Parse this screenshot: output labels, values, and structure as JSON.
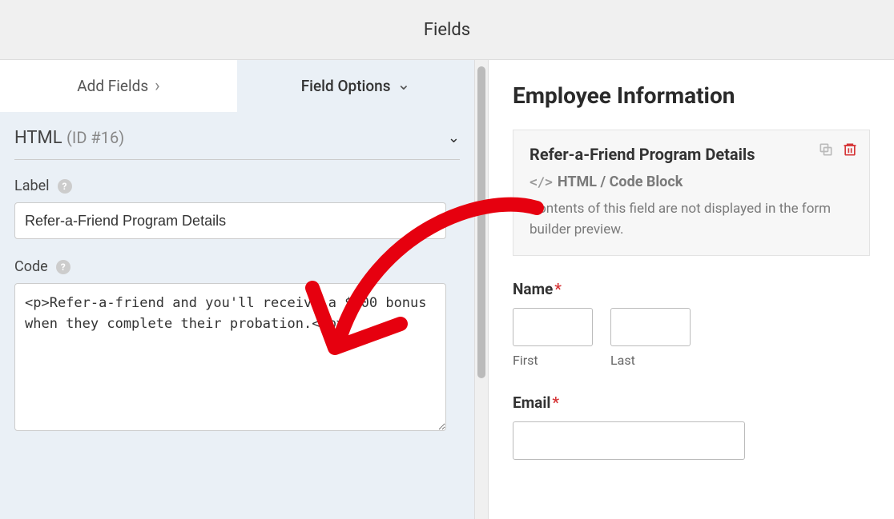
{
  "topbar": {
    "title": "Fields"
  },
  "tabs": {
    "add_fields": "Add Fields",
    "field_options": "Field Options"
  },
  "field": {
    "type_label": "HTML",
    "id_label": "(ID #16)",
    "label_heading": "Label",
    "label_value": "Refer-a-Friend Program Details",
    "code_heading": "Code",
    "code_value": "<p>Refer-a-friend and you'll receive a $200 bonus when they complete their probation.</p>"
  },
  "preview": {
    "title": "Employee Information",
    "html_block": {
      "title": "Refer-a-Friend Program Details",
      "subtitle": "HTML / Code Block",
      "description": "Contents of this field are not displayed in the form builder preview."
    },
    "name": {
      "label": "Name",
      "first": "First",
      "last": "Last"
    },
    "email": {
      "label": "Email"
    }
  }
}
